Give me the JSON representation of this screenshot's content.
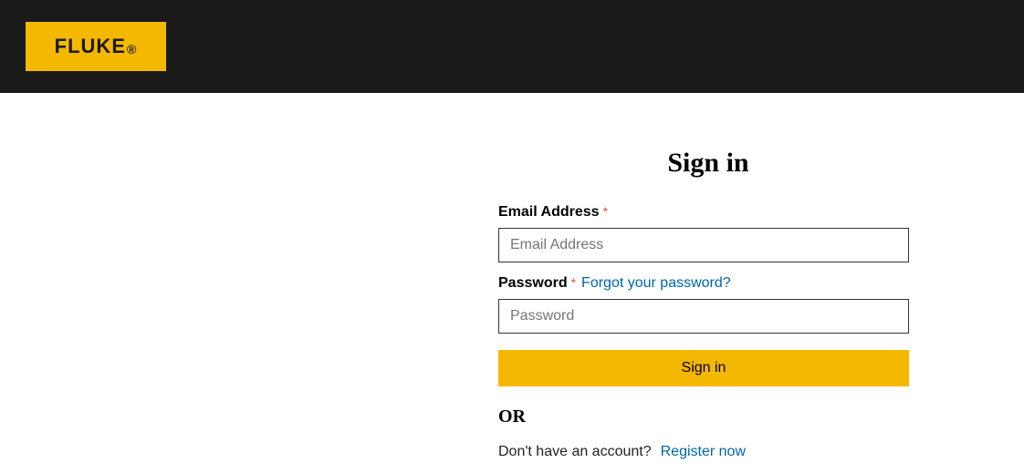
{
  "brand": "FLUKE",
  "signin": {
    "title": "Sign in",
    "email": {
      "label": "Email Address",
      "placeholder": "Email Address"
    },
    "password": {
      "label": "Password",
      "placeholder": "Password",
      "forgot_link": "Forgot your password?"
    },
    "submit_label": "Sign in",
    "divider": "OR",
    "register_prompt": "Don't have an account?",
    "register_link": "Register now"
  },
  "required_marker": "*"
}
